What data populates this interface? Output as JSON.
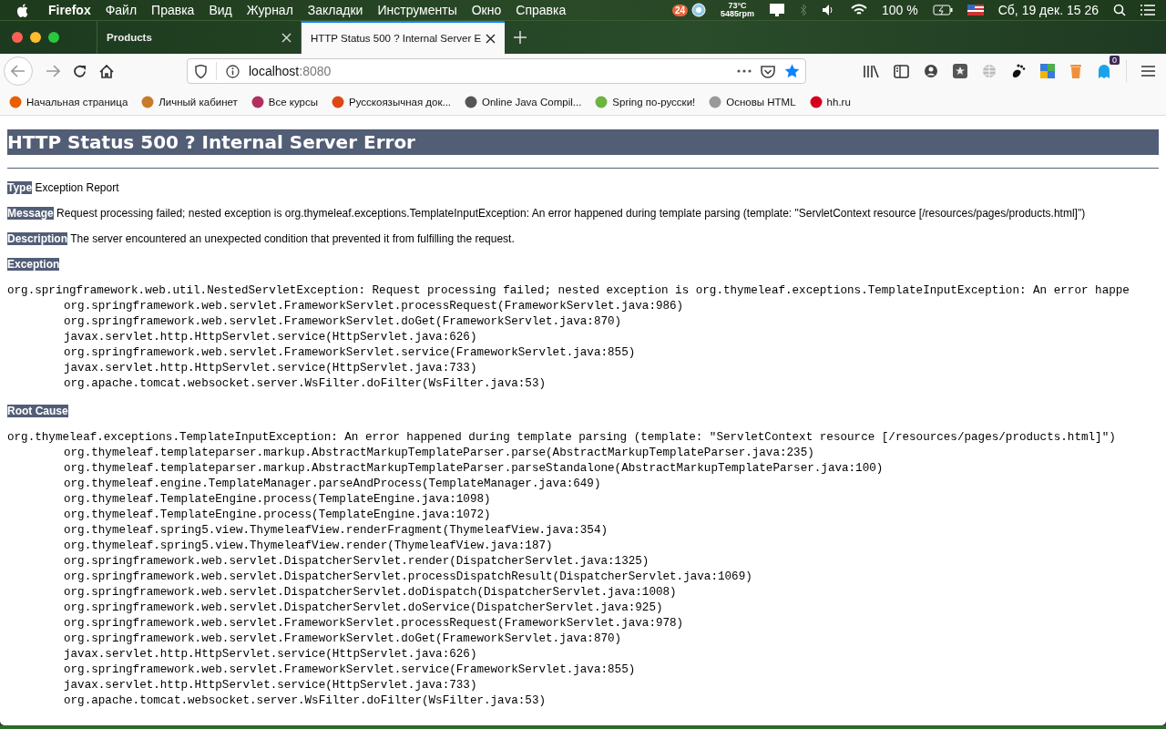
{
  "menu_bar": {
    "app": "Firefox",
    "items": [
      "Файл",
      "Правка",
      "Вид",
      "Журнал",
      "Закладки",
      "Инструменты",
      "Окно",
      "Справка"
    ],
    "status": {
      "badge": "24",
      "temperature": "73°C",
      "fan": "5485rpm",
      "battery": "100 %",
      "datetime": "Сб, 19 дек.  15 26"
    }
  },
  "tabs": [
    {
      "title": "Products",
      "selected": false
    },
    {
      "title": "HTTP Status 500 ? Internal Server E",
      "selected": true
    }
  ],
  "toolbar": {
    "url_host": "localhost",
    "url_port": ":8080",
    "extension_badge": "0"
  },
  "bookmarks": [
    "Начальная страница",
    "Личный кабинет",
    "Все курсы",
    "Русскоязычная док...",
    "Online Java Compil...",
    "Spring по-русски!",
    "Основы HTML",
    "hh.ru"
  ],
  "page": {
    "title": "HTTP Status 500 ? Internal Server Error",
    "fields": [
      {
        "label": "Type",
        "text": "Exception Report"
      },
      {
        "label": "Message",
        "text": "Request processing failed; nested exception is org.thymeleaf.exceptions.TemplateInputException: An error happened during template parsing (template: \"ServletContext resource [/resources/pages/products.html]\")"
      },
      {
        "label": "Description",
        "text": "The server encountered an unexpected condition that prevented it from fulfilling the request."
      }
    ],
    "traces": [
      {
        "heading": "Exception",
        "exception": "org.springframework.web.util.NestedServletException: Request processing failed; nested exception is org.thymeleaf.exceptions.TemplateInputException: An error happe",
        "frames": [
          "org.springframework.web.servlet.FrameworkServlet.processRequest(FrameworkServlet.java:986)",
          "org.springframework.web.servlet.FrameworkServlet.doGet(FrameworkServlet.java:870)",
          "javax.servlet.http.HttpServlet.service(HttpServlet.java:626)",
          "org.springframework.web.servlet.FrameworkServlet.service(FrameworkServlet.java:855)",
          "javax.servlet.http.HttpServlet.service(HttpServlet.java:733)",
          "org.apache.tomcat.websocket.server.WsFilter.doFilter(WsFilter.java:53)"
        ]
      },
      {
        "heading": "Root Cause",
        "exception": "org.thymeleaf.exceptions.TemplateInputException: An error happened during template parsing (template: \"ServletContext resource [/resources/pages/products.html]\")",
        "frames": [
          "org.thymeleaf.templateparser.markup.AbstractMarkupTemplateParser.parse(AbstractMarkupTemplateParser.java:235)",
          "org.thymeleaf.templateparser.markup.AbstractMarkupTemplateParser.parseStandalone(AbstractMarkupTemplateParser.java:100)",
          "org.thymeleaf.engine.TemplateManager.parseAndProcess(TemplateManager.java:649)",
          "org.thymeleaf.TemplateEngine.process(TemplateEngine.java:1098)",
          "org.thymeleaf.TemplateEngine.process(TemplateEngine.java:1072)",
          "org.thymeleaf.spring5.view.ThymeleafView.renderFragment(ThymeleafView.java:354)",
          "org.thymeleaf.spring5.view.ThymeleafView.render(ThymeleafView.java:187)",
          "org.springframework.web.servlet.DispatcherServlet.render(DispatcherServlet.java:1325)",
          "org.springframework.web.servlet.DispatcherServlet.processDispatchResult(DispatcherServlet.java:1069)",
          "org.springframework.web.servlet.DispatcherServlet.doDispatch(DispatcherServlet.java:1008)",
          "org.springframework.web.servlet.DispatcherServlet.doService(DispatcherServlet.java:925)",
          "org.springframework.web.servlet.FrameworkServlet.processRequest(FrameworkServlet.java:978)",
          "org.springframework.web.servlet.FrameworkServlet.doGet(FrameworkServlet.java:870)",
          "javax.servlet.http.HttpServlet.service(HttpServlet.java:626)",
          "org.springframework.web.servlet.FrameworkServlet.service(FrameworkServlet.java:855)",
          "javax.servlet.http.HttpServlet.service(HttpServlet.java:733)",
          "org.apache.tomcat.websocket.server.WsFilter.doFilter(WsFilter.java:53)"
        ]
      }
    ]
  }
}
